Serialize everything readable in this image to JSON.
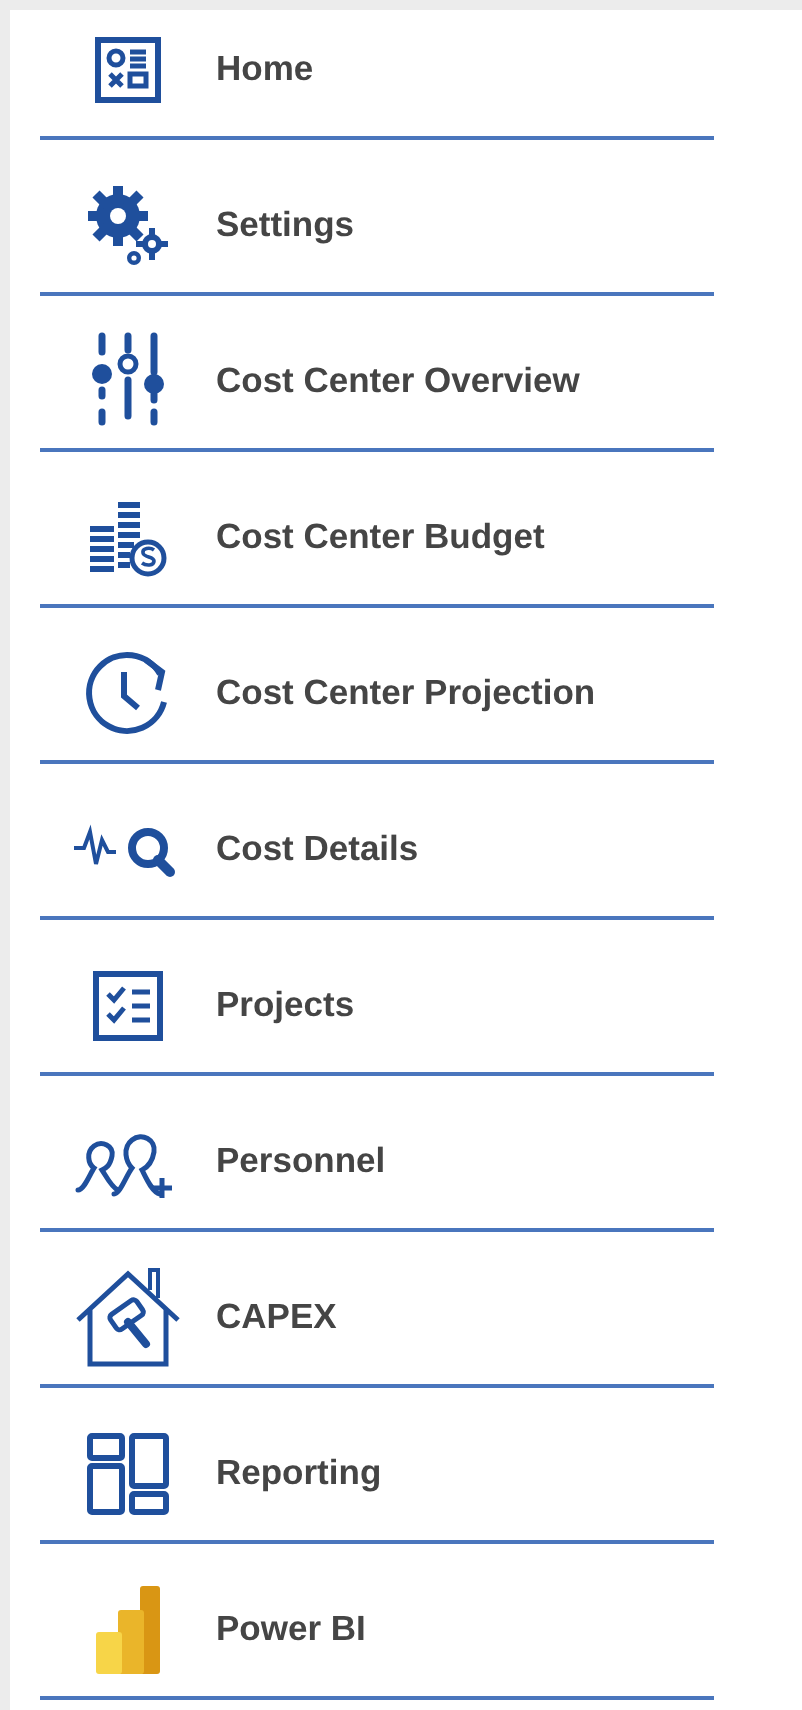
{
  "nav": {
    "items": [
      {
        "label": "Home"
      },
      {
        "label": "Settings"
      },
      {
        "label": "Cost Center Overview"
      },
      {
        "label": "Cost Center Budget"
      },
      {
        "label": "Cost Center Projection"
      },
      {
        "label": "Cost Details"
      },
      {
        "label": "Projects"
      },
      {
        "label": "Personnel"
      },
      {
        "label": "CAPEX"
      },
      {
        "label": "Reporting"
      },
      {
        "label": "Power BI"
      }
    ]
  }
}
